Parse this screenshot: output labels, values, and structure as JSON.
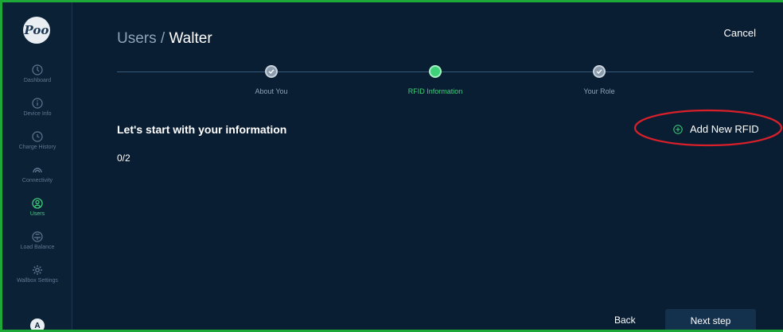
{
  "app": {
    "logo_text": "Poo"
  },
  "sidebar": {
    "items": [
      {
        "label": "Dashboard",
        "icon": "dashboard-icon"
      },
      {
        "label": "Device Info",
        "icon": "info-icon"
      },
      {
        "label": "Charge History",
        "icon": "clock-icon"
      },
      {
        "label": "Connectivity",
        "icon": "connectivity-icon"
      },
      {
        "label": "Users",
        "icon": "user-icon",
        "active": true
      },
      {
        "label": "Load Balance",
        "icon": "load-balance-icon"
      },
      {
        "label": "Wallbox Settings",
        "icon": "gear-icon"
      }
    ],
    "avatar_initial": "A"
  },
  "header": {
    "breadcrumb_parent": "Users / ",
    "breadcrumb_current": "Walter",
    "cancel_label": "Cancel"
  },
  "stepper": {
    "steps": [
      {
        "label": "About You",
        "state": "done"
      },
      {
        "label": "RFID Information",
        "state": "current"
      },
      {
        "label": "Your Role",
        "state": "done"
      }
    ]
  },
  "main": {
    "section_title": "Let's start with your information",
    "count_text": "0/2",
    "add_rfid_label": "Add New RFID"
  },
  "footer": {
    "back_label": "Back",
    "next_label": "Next step"
  },
  "colors": {
    "accent": "#3fd07a",
    "background": "#0a1e33",
    "annotation": "#d9202a"
  }
}
